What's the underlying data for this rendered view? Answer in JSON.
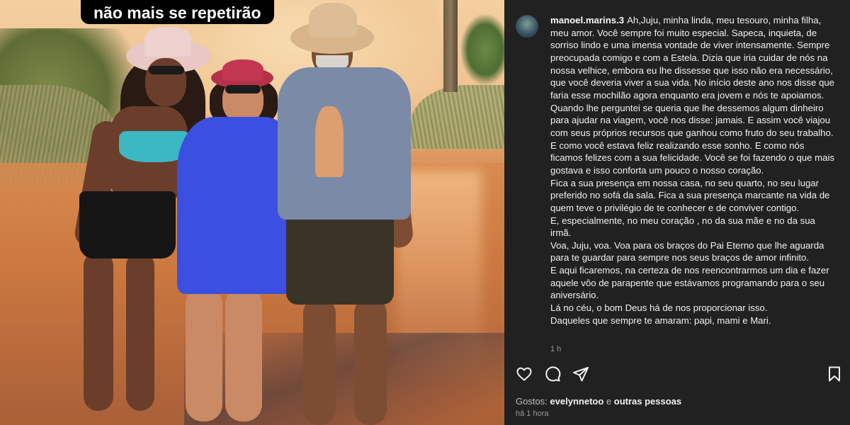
{
  "photo": {
    "overlay_caption": "não mais se repetirão"
  },
  "post": {
    "username": "manoel.marins.3",
    "caption": "Ah,Juju, minha linda, meu tesouro, minha filha, meu amor. Você sempre foi muito especial. Sapeca, inquieta, de sorriso lindo e uma imensa vontade de viver intensamente. Sempre preocupada comigo e com a Estela. Dizia que iria cuidar de nós na nossa velhice, embora eu lhe dissesse que isso não era necessário, que você deveria viver a sua vida. No início deste ano nos disse que faria esse mochilão agora enquanto era jovem e nós te apoiamos. Quando lhe perguntei se queria que lhe dessemos algum dinheiro para ajudar na viagem, você nos disse: jamais. E assim você viajou com seus próprios recursos que ganhou como fruto do seu trabalho. E como você estava feliz realizando esse sonho. E como nós ficamos felizes com a sua felicidade. Você se foi fazendo o que mais gostava e isso conforta um pouco o nosso coração.\nFica a sua presença em nossa casa, no seu quarto, no seu lugar preferido no sofá da sala. Fica a sua presença marcante na vida de quem teve o privilégio de te conhecer e de conviver contigo.\nE, especialmente, no meu coração , no da sua mãe e no da sua irmã.\nVoa, Juju, voa. Voa para os braços do Pai Eterno que lhe aguarda para te guardar para sempre nos seus braços de amor infinito.\nE aqui ficaremos, na certeza de nos reencontrarmos um dia e fazer aquele vôo de parapente que estávamos programando para o seu aniversário.\nLá no céu, o bom Deus há de nos proporcionar isso.\nDaqueles que sempre te amaram: papi, mami e Mari.",
    "comment_time": "1 h",
    "likes_prefix": "Gostos:",
    "likes_user": "evelynnetoo",
    "likes_join": "e",
    "likes_others": "outras pessoas",
    "posted_time": "há 1 hora"
  },
  "icons": {
    "like": "heart-icon",
    "comment": "comment-icon",
    "share": "share-icon",
    "save": "bookmark-icon"
  }
}
